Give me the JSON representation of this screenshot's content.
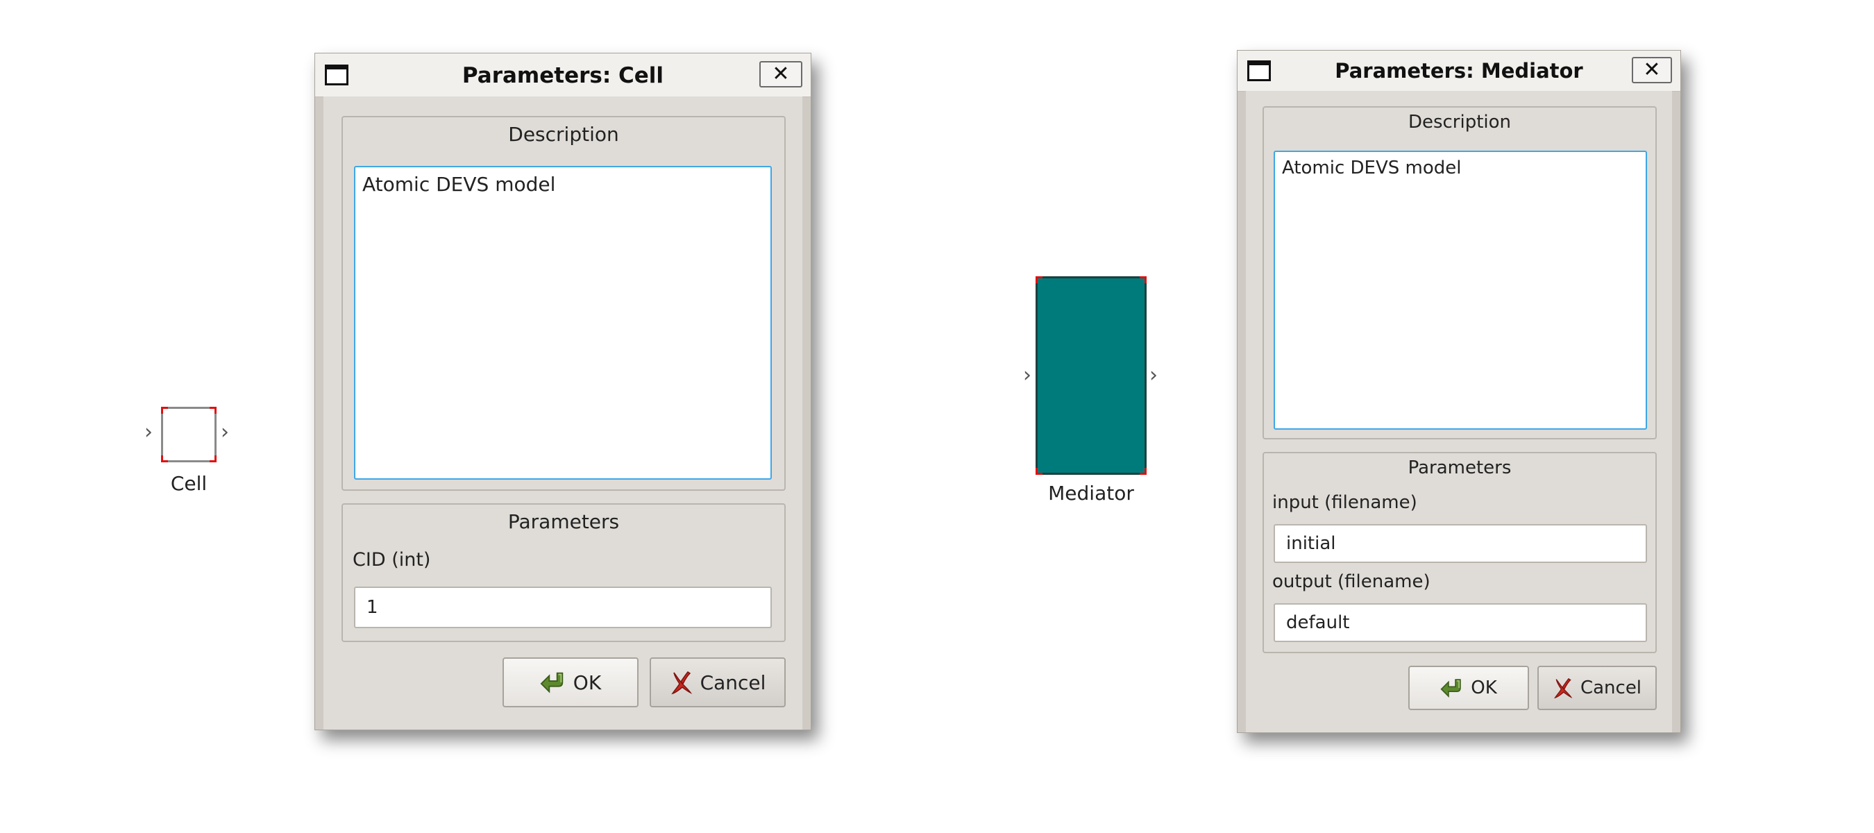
{
  "canvas": {
    "blocks": [
      {
        "label": "Cell",
        "fill": "#ffffff"
      },
      {
        "label": "Mediator",
        "fill": "#007b7b"
      }
    ],
    "port_glyph": "›"
  },
  "dialogs": {
    "cell": {
      "title": "Parameters: Cell",
      "close_glyph": "✕",
      "description_group": "Description",
      "description_text": "Atomic DEVS model",
      "parameters_group": "Parameters",
      "fields": [
        {
          "label": "CID (int)",
          "value": "1"
        }
      ],
      "ok_label": "OK",
      "cancel_label": "Cancel"
    },
    "mediator": {
      "title": "Parameters: Mediator",
      "close_glyph": "✕",
      "description_group": "Description",
      "description_text": "Atomic DEVS model",
      "parameters_group": "Parameters",
      "fields": [
        {
          "label": "input (filename)",
          "value": "initial"
        },
        {
          "label": "output (filename)",
          "value": "default"
        }
      ],
      "ok_label": "OK",
      "cancel_label": "Cancel"
    }
  },
  "colors": {
    "selection_handle": "#e01010",
    "focus_border": "#3fa7e6",
    "dialog_bg": "#dfdcd7",
    "mediator_fill": "#007b7b"
  }
}
